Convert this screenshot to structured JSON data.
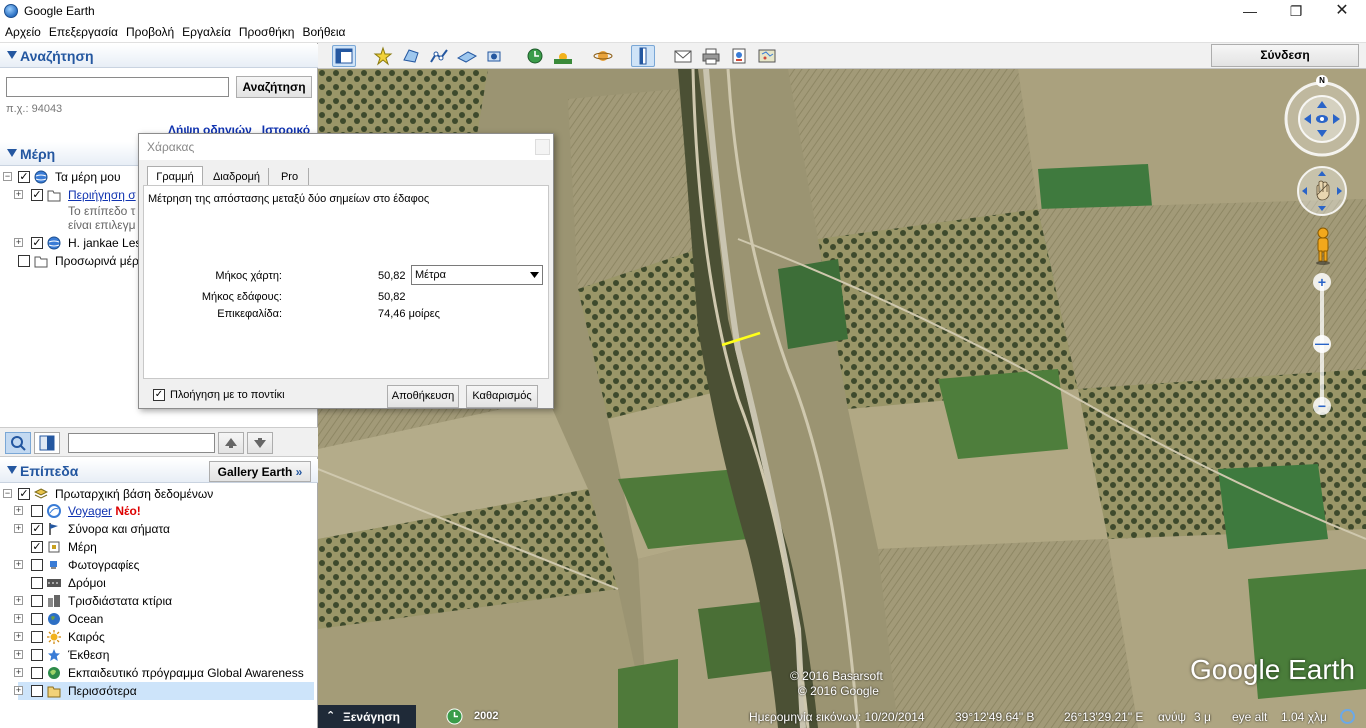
{
  "window": {
    "title": "Google Earth"
  },
  "menu": [
    "Αρχείο",
    "Επεξεργασία",
    "Προβολή",
    "Εργαλεία",
    "Προσθήκη",
    "Βοήθεια"
  ],
  "search": {
    "header": "Αναζήτηση",
    "button": "Αναζήτηση",
    "value": "",
    "hint": "π.χ.: 94043",
    "links": "Λήψη οδηγιών   Ιστορικό"
  },
  "places": {
    "header": "Μέρη",
    "items": [
      {
        "label": "Τα μέρη μου"
      },
      {
        "label": "Περιήγηση σ"
      },
      {
        "label": "Το επίπεδο τ"
      },
      {
        "label": "είναι επιλεγμ"
      },
      {
        "label": "H. jankae Les"
      },
      {
        "label": "Προσωρινά μέρ"
      }
    ]
  },
  "layers": {
    "header": "Επίπεδα",
    "gallery_button": "Gallery Earth",
    "gallery_chevron": "»",
    "items": [
      {
        "label": "Πρωταρχική βάση δεδομένων"
      },
      {
        "label": "Voyager",
        "badge": "Νέο!"
      },
      {
        "label": "Σύνορα και σήματα"
      },
      {
        "label": "Μέρη"
      },
      {
        "label": "Φωτογραφίες"
      },
      {
        "label": "Δρόμοι"
      },
      {
        "label": "Τρισδιάστατα κτίρια"
      },
      {
        "label": "Ocean"
      },
      {
        "label": "Καιρός"
      },
      {
        "label": "Έκθεση"
      },
      {
        "label": "Εκπαιδευτικό πρόγραμμα Global Awareness"
      },
      {
        "label": "Περισσότερα"
      }
    ]
  },
  "signin": "Σύνδεση",
  "ruler": {
    "title": "Χάρακας",
    "tabs": [
      "Γραμμή",
      "Διαδρομή",
      "Pro"
    ],
    "description": "Μέτρηση της απόστασης μεταξύ δύο σημείων στο έδαφος",
    "map_length_label": "Μήκος χάρτη:",
    "map_length_value": "50,82",
    "unit": "Μέτρα",
    "ground_length_label": "Μήκος εδάφους:",
    "ground_length_value": "50,82",
    "heading_label": "Επικεφαλίδα:",
    "heading_value": "74,46 μοίρες",
    "mouse_nav": "Πλοήγηση με το ποντίκι",
    "save": "Αποθήκευση",
    "clear": "Καθαρισμός"
  },
  "map": {
    "compass_n": "N",
    "copyright1": "© 2016 Basarsoft",
    "copyright2": "© 2016 Google",
    "brand": "Google Earth"
  },
  "status": {
    "tour": "Ξενάγηση",
    "year": "2002",
    "imagery_date": "Ημερομηνία εικόνων: 10/20/2014",
    "lat": "39°12'49.64\" Β",
    "lon": "26°13'29.21\" Ε",
    "elev_label": "ανύψ",
    "elev": "3 μ",
    "eye_alt_label": "eye alt",
    "eye_alt": "1.04 χλμ"
  }
}
